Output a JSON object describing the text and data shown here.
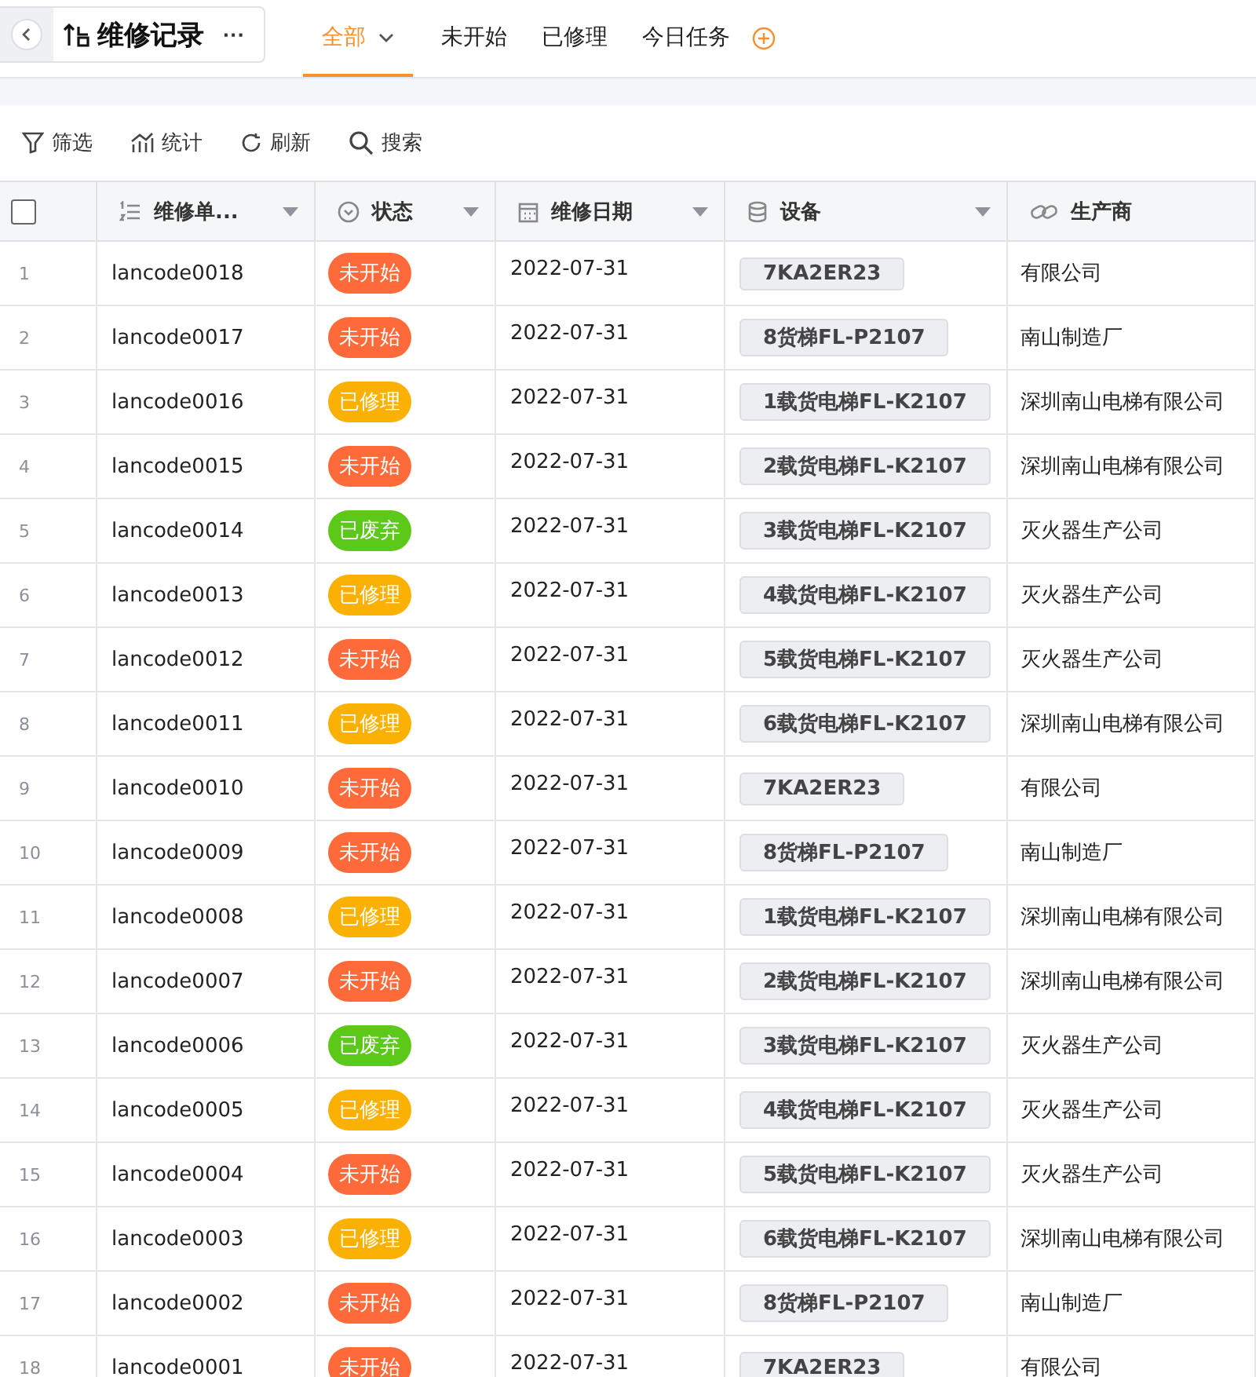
{
  "header": {
    "title": "维修记录",
    "more": "···"
  },
  "view_tabs": [
    {
      "label": "全部",
      "selected": true,
      "has_menu": true
    },
    {
      "label": "未开始",
      "selected": false,
      "has_menu": false
    },
    {
      "label": "已修理",
      "selected": false,
      "has_menu": false
    },
    {
      "label": "今日任务",
      "selected": false,
      "has_menu": false
    }
  ],
  "toolbar": [
    {
      "label": "筛选",
      "kind": "filter"
    },
    {
      "label": "统计",
      "kind": "stats"
    },
    {
      "label": "刷新",
      "kind": "refresh"
    },
    {
      "label": "搜索",
      "kind": "search"
    }
  ],
  "table": {
    "select_all": {
      "checked": false
    },
    "columns": [
      {
        "label": "维修单...",
        "kind": "number",
        "has_menu": true
      },
      {
        "label": "状态",
        "kind": "select",
        "has_menu": true
      },
      {
        "label": "维修日期",
        "kind": "date",
        "has_menu": true
      },
      {
        "label": "设备",
        "kind": "database",
        "has_menu": true
      },
      {
        "label": "生产商",
        "kind": "link",
        "has_menu": false
      }
    ],
    "rows": [
      {
        "index": "1",
        "code": "lancode0018",
        "status": {
          "label": "未开始",
          "color": "#ff6a3a"
        },
        "date": "2022-07-31",
        "device": "7KA2ER23",
        "maker": "有限公司"
      },
      {
        "index": "2",
        "code": "lancode0017",
        "status": {
          "label": "未开始",
          "color": "#ff6a3a"
        },
        "date": "2022-07-31",
        "device": "8货梯FL-P2107",
        "maker": "南山制造厂"
      },
      {
        "index": "3",
        "code": "lancode0016",
        "status": {
          "label": "已修理",
          "color": "#fbb004"
        },
        "date": "2022-07-31",
        "device": "1载货电梯FL-K2107",
        "maker": "深圳南山电梯有限公司"
      },
      {
        "index": "4",
        "code": "lancode0015",
        "status": {
          "label": "未开始",
          "color": "#ff6a3a"
        },
        "date": "2022-07-31",
        "device": "2载货电梯FL-K2107",
        "maker": "深圳南山电梯有限公司"
      },
      {
        "index": "5",
        "code": "lancode0014",
        "status": {
          "label": "已废弃",
          "color": "#5cc91a"
        },
        "date": "2022-07-31",
        "device": "3载货电梯FL-K2107",
        "maker": "灭火器生产公司"
      },
      {
        "index": "6",
        "code": "lancode0013",
        "status": {
          "label": "已修理",
          "color": "#fbb004"
        },
        "date": "2022-07-31",
        "device": "4载货电梯FL-K2107",
        "maker": "灭火器生产公司"
      },
      {
        "index": "7",
        "code": "lancode0012",
        "status": {
          "label": "未开始",
          "color": "#ff6a3a"
        },
        "date": "2022-07-31",
        "device": "5载货电梯FL-K2107",
        "maker": "灭火器生产公司"
      },
      {
        "index": "8",
        "code": "lancode0011",
        "status": {
          "label": "已修理",
          "color": "#fbb004"
        },
        "date": "2022-07-31",
        "device": "6载货电梯FL-K2107",
        "maker": "深圳南山电梯有限公司"
      },
      {
        "index": "9",
        "code": "lancode0010",
        "status": {
          "label": "未开始",
          "color": "#ff6a3a"
        },
        "date": "2022-07-31",
        "device": "7KA2ER23",
        "maker": "有限公司"
      },
      {
        "index": "10",
        "code": "lancode0009",
        "status": {
          "label": "未开始",
          "color": "#ff6a3a"
        },
        "date": "2022-07-31",
        "device": "8货梯FL-P2107",
        "maker": "南山制造厂"
      },
      {
        "index": "11",
        "code": "lancode0008",
        "status": {
          "label": "已修理",
          "color": "#fbb004"
        },
        "date": "2022-07-31",
        "device": "1载货电梯FL-K2107",
        "maker": "深圳南山电梯有限公司"
      },
      {
        "index": "12",
        "code": "lancode0007",
        "status": {
          "label": "未开始",
          "color": "#ff6a3a"
        },
        "date": "2022-07-31",
        "device": "2载货电梯FL-K2107",
        "maker": "深圳南山电梯有限公司"
      },
      {
        "index": "13",
        "code": "lancode0006",
        "status": {
          "label": "已废弃",
          "color": "#5cc91a"
        },
        "date": "2022-07-31",
        "device": "3载货电梯FL-K2107",
        "maker": "灭火器生产公司"
      },
      {
        "index": "14",
        "code": "lancode0005",
        "status": {
          "label": "已修理",
          "color": "#fbb004"
        },
        "date": "2022-07-31",
        "device": "4载货电梯FL-K2107",
        "maker": "灭火器生产公司"
      },
      {
        "index": "15",
        "code": "lancode0004",
        "status": {
          "label": "未开始",
          "color": "#ff6a3a"
        },
        "date": "2022-07-31",
        "device": "5载货电梯FL-K2107",
        "maker": "灭火器生产公司"
      },
      {
        "index": "16",
        "code": "lancode0003",
        "status": {
          "label": "已修理",
          "color": "#fbb004"
        },
        "date": "2022-07-31",
        "device": "6载货电梯FL-K2107",
        "maker": "深圳南山电梯有限公司"
      },
      {
        "index": "17",
        "code": "lancode0002",
        "status": {
          "label": "未开始",
          "color": "#ff6a3a"
        },
        "date": "2022-07-31",
        "device": "8货梯FL-P2107",
        "maker": "南山制造厂"
      },
      {
        "index": "18",
        "code": "lancode0001",
        "status": {
          "label": "未开始",
          "color": "#ff6a3a"
        },
        "date": "2022-07-31",
        "device": "7KA2ER23",
        "maker": "有限公司"
      }
    ]
  }
}
